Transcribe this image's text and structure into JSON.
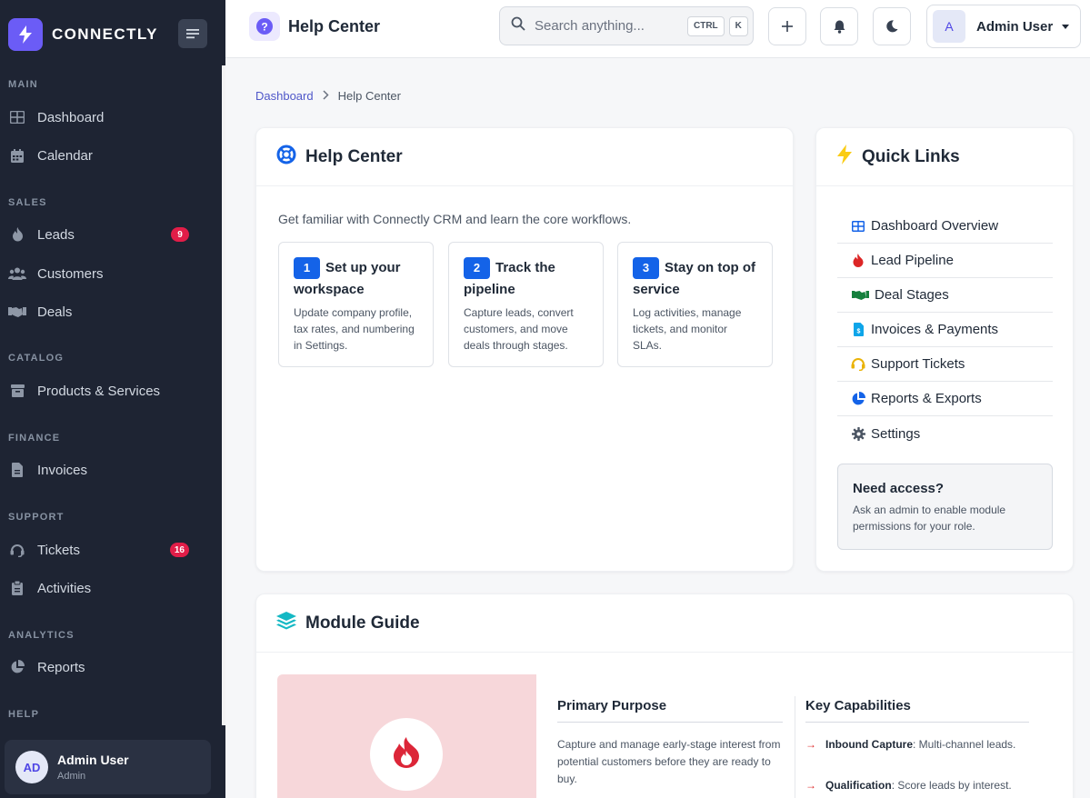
{
  "brand": {
    "name": "CONNECTLY"
  },
  "sidebar": {
    "sections": [
      {
        "label": "MAIN"
      },
      {
        "label": "SALES"
      },
      {
        "label": "CATALOG"
      },
      {
        "label": "FINANCE"
      },
      {
        "label": "SUPPORT"
      },
      {
        "label": "ANALYTICS"
      },
      {
        "label": "HELP"
      }
    ],
    "items": [
      {
        "label": "Dashboard",
        "icon": "grid-icon"
      },
      {
        "label": "Calendar",
        "icon": "calendar-icon"
      },
      {
        "label": "Leads",
        "icon": "fire-icon",
        "badge": "9"
      },
      {
        "label": "Customers",
        "icon": "users-icon"
      },
      {
        "label": "Deals",
        "icon": "handshake-icon"
      },
      {
        "label": "Products & Services",
        "icon": "box-icon"
      },
      {
        "label": "Invoices",
        "icon": "invoice-icon"
      },
      {
        "label": "Tickets",
        "icon": "headset-icon",
        "badge": "16"
      },
      {
        "label": "Activities",
        "icon": "clipboard-icon"
      },
      {
        "label": "Reports",
        "icon": "pie-chart-icon"
      }
    ],
    "user": {
      "initials": "AD",
      "name": "Admin User",
      "role": "Admin"
    }
  },
  "header": {
    "title": "Help Center",
    "search_placeholder": "Search anything...",
    "shortcut_keys": [
      "CTRL",
      "K"
    ],
    "account": {
      "initial": "A",
      "name": "Admin User"
    }
  },
  "breadcrumb": {
    "parent": "Dashboard",
    "current": "Help Center"
  },
  "help_center": {
    "title": "Help Center",
    "intro": "Get familiar with Connectly CRM and learn the core workflows.",
    "steps": [
      {
        "num": "1",
        "title": "Set up your workspace",
        "desc": "Update company profile, tax rates, and numbering in Settings."
      },
      {
        "num": "2",
        "title": "Track the pipeline",
        "desc": "Capture leads, convert customers, and move deals through stages."
      },
      {
        "num": "3",
        "title": "Stay on top of service",
        "desc": "Log activities, manage tickets, and monitor SLAs."
      }
    ]
  },
  "quick_links": {
    "title": "Quick Links",
    "items": [
      {
        "label": "Dashboard Overview",
        "icon": "grid-icon",
        "color": "#1463e8"
      },
      {
        "label": "Lead Pipeline",
        "icon": "fire-icon",
        "color": "#dc2626"
      },
      {
        "label": "Deal Stages",
        "icon": "handshake-icon",
        "color": "#15803d"
      },
      {
        "label": "Invoices & Payments",
        "icon": "invoice-icon",
        "color": "#0ea5e9"
      },
      {
        "label": "Support Tickets",
        "icon": "headset-icon",
        "color": "#eab308"
      },
      {
        "label": "Reports & Exports",
        "icon": "pie-chart-icon",
        "color": "#1463e8"
      },
      {
        "label": "Settings",
        "icon": "gear-icon",
        "color": "#4b5563"
      }
    ],
    "access": {
      "title": "Need access?",
      "desc": "Ask an admin to enable module permissions for your role."
    }
  },
  "module_guide": {
    "title": "Module Guide",
    "purpose_title": "Primary Purpose",
    "purpose_text": "Capture and manage early-stage interest from potential customers before they are ready to buy.",
    "capabilities_title": "Key Capabilities",
    "capabilities": [
      {
        "name": "Inbound Capture",
        "desc": ": Multi-channel leads."
      },
      {
        "name": "Qualification",
        "desc": ": Score leads by interest."
      }
    ]
  },
  "colors": {
    "sidebar_bg": "#1e2433",
    "accent": "#6b5cf6",
    "primary": "#1463e8",
    "badge": "#e11d48",
    "module_visual_bg": "#f7d7da"
  }
}
